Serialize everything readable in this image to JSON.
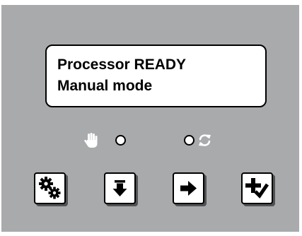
{
  "display": {
    "line1": "Processor READY",
    "line2": "Manual mode"
  },
  "indicators": {
    "manual": {
      "icon": "hand-icon",
      "state": "off"
    },
    "auto": {
      "icon": "cycle-icon",
      "state": "off"
    }
  },
  "buttons": [
    {
      "id": "settings",
      "icon": "gears-icon"
    },
    {
      "id": "down",
      "icon": "arrow-down-icon"
    },
    {
      "id": "next",
      "icon": "arrow-right-icon"
    },
    {
      "id": "confirm",
      "icon": "plus-check-icon"
    }
  ],
  "colors": {
    "panel": "#a9aaab",
    "icon_gray": "#ffffff",
    "led_off": "#ffffff",
    "button_shadow": "#505254"
  }
}
